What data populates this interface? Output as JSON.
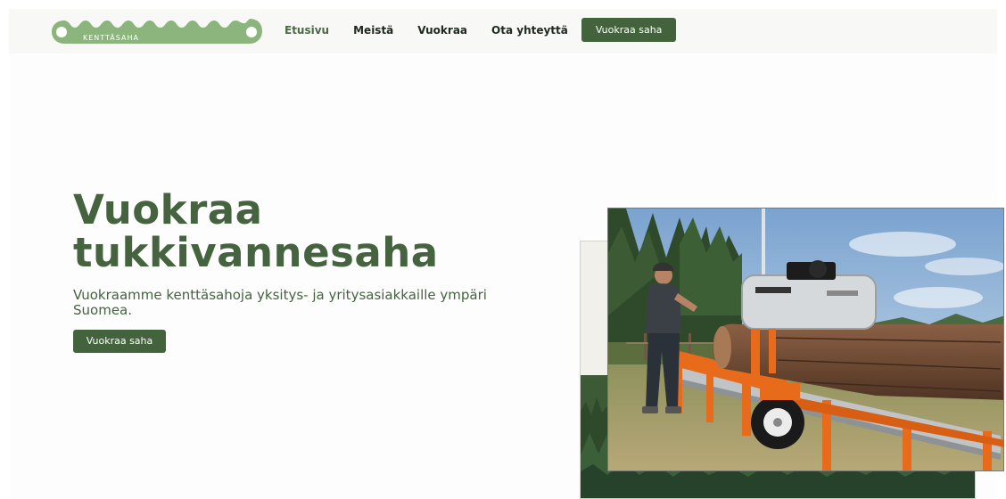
{
  "logo": {
    "text": "KENTTÄSAHA",
    "color": "#8cb57e"
  },
  "nav": {
    "items": [
      {
        "label": "Etusivu",
        "active": true
      },
      {
        "label": "Meistä",
        "active": false
      },
      {
        "label": "Vuokraa",
        "active": false
      },
      {
        "label": "Ota yhteyttä",
        "active": false
      }
    ],
    "cta_label": "Vuokraa saha"
  },
  "hero": {
    "title_line1": "Vuokraa",
    "title_line2": "tukkivannesaha",
    "subtitle": "Vuokraamme kenttäsahoja yksitys- ja yritysasiakkaille ympäri Suomea.",
    "cta_label": "Vuokraa saha"
  },
  "colors": {
    "brand_green": "#43633d",
    "heading_green": "#45633f",
    "logo_green": "#8cb57e",
    "sawmill_orange": "#e86b1c"
  },
  "icons": [
    "saw-blade-logo-icon"
  ]
}
